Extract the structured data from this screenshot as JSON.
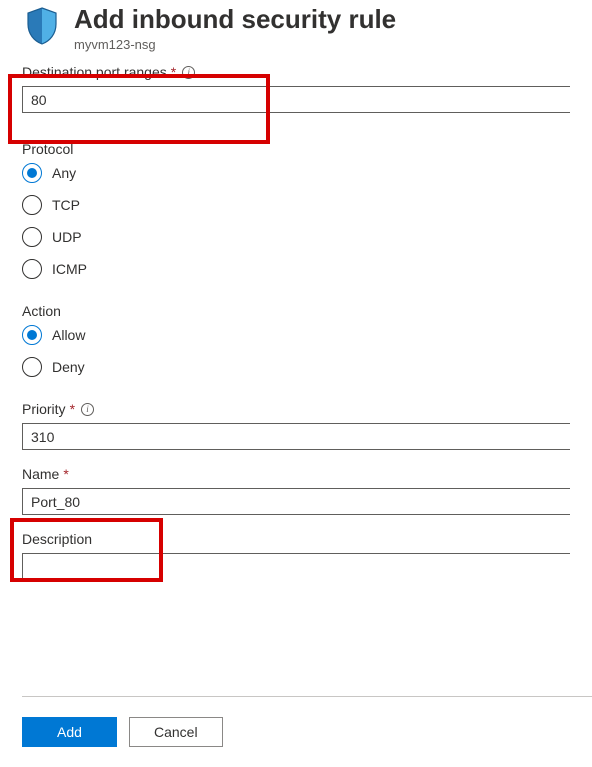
{
  "header": {
    "title": "Add inbound security rule",
    "subtitle": "myvm123-nsg"
  },
  "fields": {
    "dest_port": {
      "label": "Destination port ranges",
      "value": "80"
    },
    "protocol": {
      "label": "Protocol",
      "options": [
        "Any",
        "TCP",
        "UDP",
        "ICMP"
      ],
      "selected": "Any"
    },
    "action": {
      "label": "Action",
      "options": [
        "Allow",
        "Deny"
      ],
      "selected": "Allow"
    },
    "priority": {
      "label": "Priority",
      "value": "310"
    },
    "name": {
      "label": "Name",
      "value": "Port_80"
    },
    "description": {
      "label": "Description",
      "value": ""
    }
  },
  "buttons": {
    "add": "Add",
    "cancel": "Cancel"
  }
}
